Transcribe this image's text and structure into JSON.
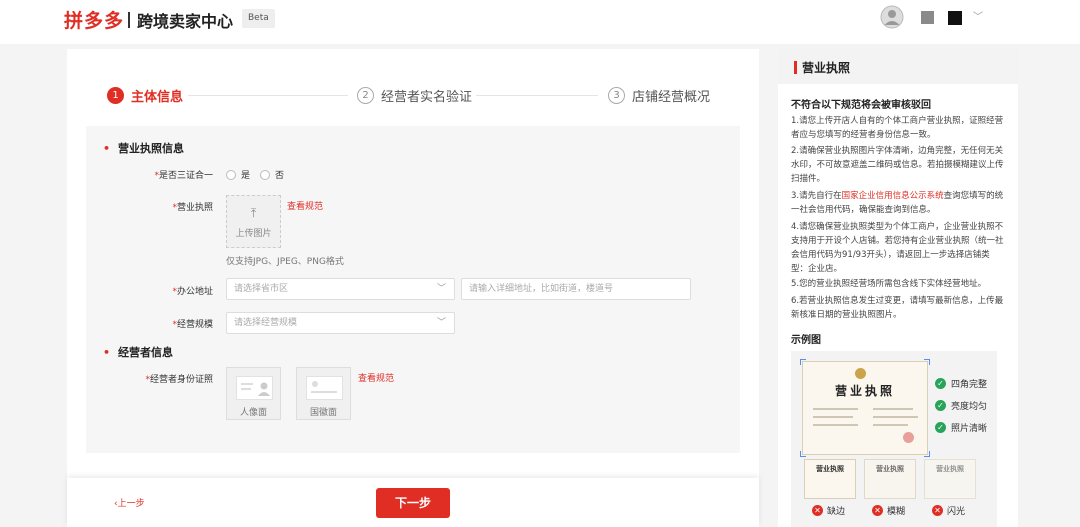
{
  "header": {
    "logo": "拼多多",
    "title": "跨境卖家中心",
    "badge": "Beta"
  },
  "steps": [
    {
      "num": "1",
      "label": "主体信息"
    },
    {
      "num": "2",
      "label": "经营者实名验证"
    },
    {
      "num": "3",
      "label": "店铺经营概况"
    }
  ],
  "form": {
    "section1": "营业执照信息",
    "three_in_one_label": "是否三证合一",
    "radio_yes": "是",
    "radio_no": "否",
    "license_label": "营业执照",
    "view_spec": "查看规范",
    "upload_label": "上传图片",
    "upload_hint": "仅支持JPG、JPEG、PNG格式",
    "office_label": "办公地址",
    "region_placeholder": "请选择省市区",
    "address_placeholder": "请输入详细地址，比如街道，楼道号",
    "scale_label": "经营规模",
    "scale_placeholder": "请选择经营规模",
    "section2": "经营者信息",
    "id_label": "经营者身份证照",
    "id_front": "人像面",
    "id_back": "国徽面",
    "view_spec2": "查看规范"
  },
  "footer": {
    "prev": "上一步",
    "next": "下一步"
  },
  "guide": {
    "title": "营业执照",
    "rules_title": "不符合以下规范将会被审核驳回",
    "rules": [
      "1.请您上传开店人自有的个体工商户营业执照，证照经营者应与您填写的经营者身份信息一致。",
      "2.请确保营业执照图片字体清晰，边角完整，无任何无关水印，不可故意遮盖二维码或信息。若拍摄模糊建议上传扫描件。",
      "3.请先自行在",
      "国家企业信用信息公示系统",
      "查询您填写的统一社会信用代码，确保能查询到信息。",
      "4.请您确保营业执照类型为个体工商户，企业营业执照不支持用于开设个人店铺。若您持有企业营业执照（统一社会信用代码为91/93开头），请返回上一步选择店铺类型：企业店。",
      "5.您的营业执照经营场所需包含线下实体经营地址。",
      "6.若营业执照信息发生过变更，请填写最新信息，上传最新核准日期的营业执照图片。"
    ],
    "sample_title": "示例图",
    "license_heading": "营业执照",
    "checks": [
      "四角完整",
      "亮度均匀",
      "照片清晰"
    ],
    "bad": [
      "缺边",
      "模糊",
      "闪光"
    ]
  },
  "colors": {
    "brand": "#e02e24",
    "ok": "#27a35a"
  }
}
